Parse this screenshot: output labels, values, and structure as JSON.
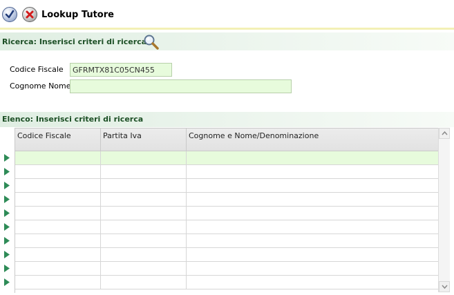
{
  "header": {
    "title": "Lookup Tutore",
    "confirm_icon": "check-icon",
    "cancel_icon": "close-icon"
  },
  "search_section": {
    "title": "Ricerca: Inserisci criteri di ricerca",
    "icon": "magnifier-icon",
    "fields": [
      {
        "label": "Codice Fiscale",
        "value": "GFRMTX81C05CN455"
      },
      {
        "label": "Cognome Nome",
        "value": ""
      }
    ]
  },
  "list_section": {
    "title": "Elenco: Inserisci criteri di ricerca",
    "columns": [
      "Codice Fiscale",
      "Partita Iva",
      "Cognome e Nome/Denominazione"
    ],
    "rows": [
      [
        "",
        "",
        ""
      ],
      [
        "",
        "",
        ""
      ],
      [
        "",
        "",
        ""
      ],
      [
        "",
        "",
        ""
      ],
      [
        "",
        "",
        ""
      ],
      [
        "",
        "",
        ""
      ],
      [
        "",
        "",
        ""
      ],
      [
        "",
        "",
        ""
      ],
      [
        "",
        "",
        ""
      ],
      [
        "",
        "",
        ""
      ]
    ],
    "selected_row": 0
  },
  "colors": {
    "input_bg": "#e7fbdc",
    "section_title": "#1c4f25",
    "row_arrow": "#2e8b57",
    "header_border": "#f3f0b5"
  }
}
